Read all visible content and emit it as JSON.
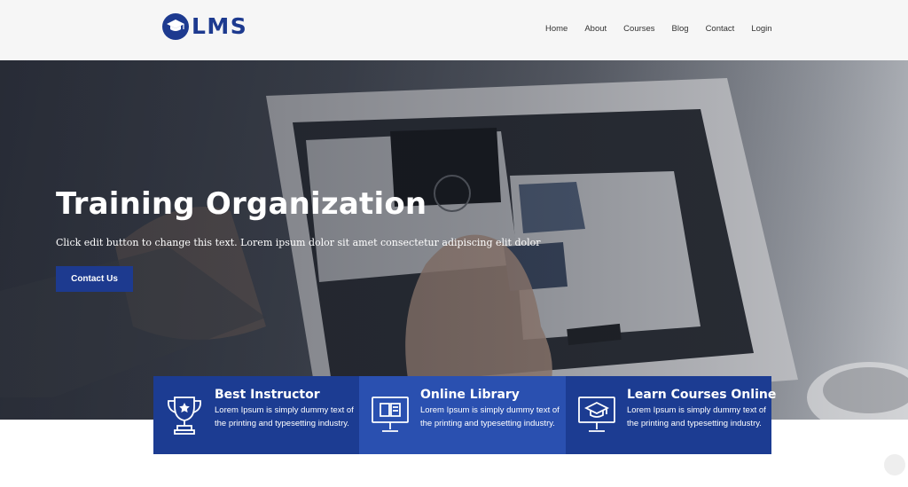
{
  "header": {
    "logo_text": "LMS",
    "nav": [
      "Home",
      "About",
      "Courses",
      "Blog",
      "Contact",
      "Login"
    ]
  },
  "hero": {
    "title": "Training Organization",
    "subtitle": "Click edit button to change this text. Lorem ipsum dolor sit amet consectetur adipiscing elit dolor",
    "button_label": "Contact Us"
  },
  "features": [
    {
      "icon": "trophy-icon",
      "title": "Best Instructor",
      "text": "Lorem Ipsum is simply dummy text of the printing and typesetting industry."
    },
    {
      "icon": "monitor-book-icon",
      "title": "Online Library",
      "text": "Lorem Ipsum is simply dummy text of the printing and typesetting industry."
    },
    {
      "icon": "monitor-graduation-cap-icon",
      "title": "Learn Courses Online",
      "text": "Lorem Ipsum is simply dummy text of the printing and typesetting industry."
    }
  ],
  "colors": {
    "brand": "#1d3a8f",
    "feature_dark": "#1c3c92",
    "feature_light": "#2a50b0",
    "header_bg": "#f6f6f6"
  }
}
